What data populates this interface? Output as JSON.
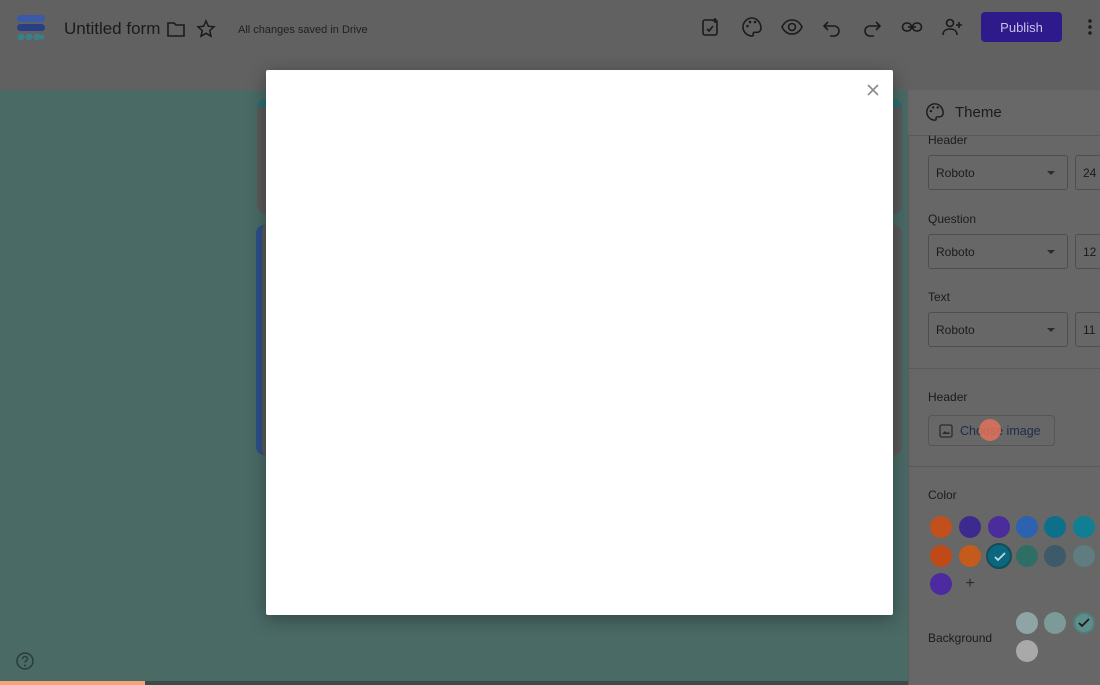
{
  "header": {
    "title": "Untitled form",
    "save_status": "All changes saved in Drive",
    "publish_label": "Publish"
  },
  "icons": {
    "logo": "forms-logo-icon",
    "folder": "folder-icon",
    "star": "star-icon",
    "customize": "add-ons-icon",
    "palette": "palette-icon",
    "preview": "eye-icon",
    "undo": "undo-icon",
    "redo": "redo-icon",
    "link": "link-icon",
    "collaborators": "person-add-icon",
    "more": "more-vert-icon",
    "help": "help-icon",
    "close": "close-icon"
  },
  "theme_panel": {
    "title": "Theme",
    "text_style": {
      "header_label": "Header",
      "header_font": "Roboto",
      "header_size": "24",
      "question_label": "Question",
      "question_font": "Roboto",
      "question_size": "12",
      "text_label": "Text",
      "text_font": "Roboto",
      "text_size": "11"
    },
    "header_image": {
      "label": "Header",
      "button_label": "Choose image"
    },
    "color": {
      "label": "Color",
      "swatches": [
        "#c1501d",
        "#3d2a8e",
        "#4a2c9a",
        "#2c62b0",
        "#0d6f8a",
        "#117f93",
        "#c04a17",
        "#c45a1c",
        "#0c6680",
        "#2f6e64",
        "#3c5a67",
        "#5f7c80",
        "#4c2aa0"
      ],
      "selected_index": 8
    },
    "background": {
      "label": "Background",
      "swatches": [
        "#8fa5a5",
        "#7b9a98",
        "#5f8e8a",
        "#a9a9a9"
      ],
      "selected_index": 2
    }
  },
  "colors": {
    "canvas": "#4a6a66",
    "publish": "#2e1a8a",
    "modal": "#ffffff",
    "progress": "#f5a37a"
  }
}
